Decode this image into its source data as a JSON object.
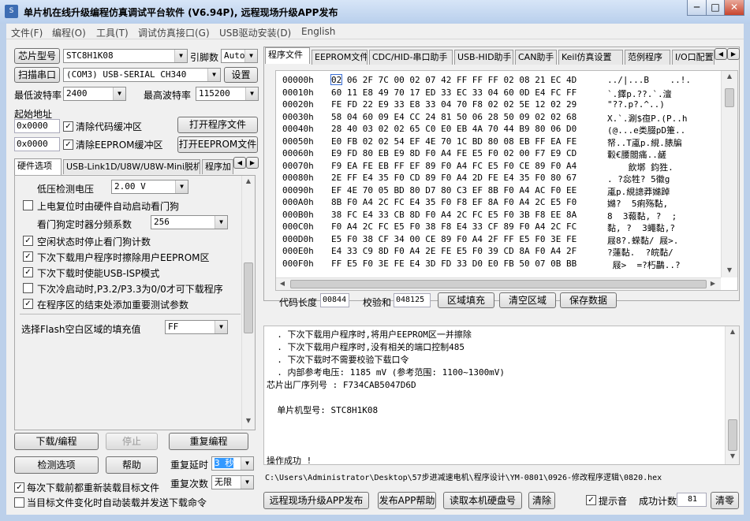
{
  "window": {
    "title": "单片机在线升级编程仿真调试平台软件 (V6.94P), 远程现场升级APP发布",
    "minimize": "─",
    "maximize": "□",
    "close": "✕"
  },
  "menu": [
    "文件(F)",
    "编程(O)",
    "工具(T)",
    "调试仿真接口(G)",
    "USB驱动安装(D)",
    "English"
  ],
  "left": {
    "chip_model_button": "芯片型号",
    "chip_model_value": "STC8H1K08",
    "pin_count_label": "引脚数",
    "pin_count_value": "Auto",
    "scan_port_button": "扫描串口",
    "port_value": "(COM3) USB-SERIAL CH340",
    "settings_button": "设置",
    "min_baud_label": "最低波特率",
    "min_baud_value": "2400",
    "max_baud_label": "最高波特率",
    "max_baud_value": "115200",
    "start_address_label": "起始地址",
    "code_addr_value": "0x0000",
    "clear_code_label": "清除代码缓冲区",
    "open_program_button": "打开程序文件",
    "eeprom_addr_value": "0x0000",
    "clear_eeprom_label": "清除EEPROM缓冲区",
    "open_eeprom_button": "打开EEPROM文件",
    "tabs": [
      "硬件选项",
      "USB-Link1D/U8W/U8W-Mini脱机",
      "程序加"
    ],
    "hw_options": {
      "lvd_label": "低压检测电压",
      "lvd_value": "2.00 V",
      "reset_wdt_label": "上电复位时由硬件自动启动看门狗",
      "wdt_prescale_label": "看门狗定时器分频系数",
      "wdt_prescale_value": "256",
      "idle_stop_wdt_label": "空闲状态时停止看门狗计数",
      "erase_eeprom_label": "下次下载用户程序时擦除用户EEPROM区",
      "usb_isp_label": "下次下载时使能USB-ISP模式",
      "p32_p33_label": "下次冷启动时,P3.2/P3.3为0/0才可下载程序",
      "add_params_label": "在程序区的结束处添加重要测试参数",
      "flash_fill_label": "选择Flash空白区域的填充值",
      "flash_fill_value": "FF"
    },
    "download_button": "下载/编程",
    "stop_button": "停止",
    "repeat_program_button": "重复编程",
    "check_options_button": "检测选项",
    "help_button": "帮助",
    "repeat_delay_label": "重复延时",
    "repeat_delay_value": "3 秒",
    "repeat_count_label": "重复次数",
    "repeat_count_value": "无限",
    "reload_label": "每次下载前都重新装载目标文件",
    "auto_load_label": "当目标文件变化时自动装载并发送下载命令"
  },
  "right": {
    "tabs": [
      "程序文件",
      "EEPROM文件",
      "CDC/HID-串口助手",
      "USB-HID助手",
      "CAN助手",
      "Keil仿真设置",
      "范例程序",
      "I/O口配置"
    ],
    "hex_rows": [
      {
        "addr": "00000h",
        "bytes": "02 06 2F 7C 00 02 07 42 FF FF FF 02 08 21 EC 4D",
        "ascii": "../|...B    ..!."
      },
      {
        "addr": "00010h",
        "bytes": "60 11 E8 49 70 17 ED 33 EC 33 04 60 0D E4 FC FF",
        "ascii": "`.鐸p.??.`.澶"
      },
      {
        "addr": "00020h",
        "bytes": "FE FD 22 E9 33 E8 33 04 70 F8 02 02 5E 12 02 29",
        "ascii": "\"??.p?.^..)"
      },
      {
        "addr": "00030h",
        "bytes": "58 04 60 09 E4 CC 24 81 50 06 28 50 09 02 02 68",
        "ascii": "X.`.涮$亱P.(P..h"
      },
      {
        "addr": "00040h",
        "bytes": "28 40 03 02 02 65 C0 E0 EB 4A 70 44 B9 80 06 D0",
        "ascii": "(@...e类腏pD箑.."
      },
      {
        "addr": "00050h",
        "bytes": "E0 FB 02 02 54 EF 4E 70 1C BD 80 08 EB FF EA FE",
        "ascii": "帑..T颪p.絸.脿牑"
      },
      {
        "addr": "00060h",
        "bytes": "E9 FD 80 EB E9 8D F0 A4 FE E5 F0 02 00 F7 E9 CD",
        "ascii": "轂€腰閸痛..鹾"
      },
      {
        "addr": "00070h",
        "bytes": "F9 EA FE EB FF EF 89 F0 A4 FC E5 F0 CE 89 F0 A4",
        "ascii": "    飲墎 鈞狌."
      },
      {
        "addr": "00080h",
        "bytes": "2E FF E4 35 F0 CD 89 F0 A4 2D FE E4 35 F0 80 67",
        "ascii": ". ?惢牲? 5徽g"
      },
      {
        "addr": "00090h",
        "bytes": "EF 4E 70 05 BD 80 D7 80 C3 EF 8B F0 A4 AC F0 EE",
        "ascii": "颪p.絸謥莽嬵踔"
      },
      {
        "addr": "000A0h",
        "bytes": "8B F0 A4 2C FC E4 35 F0 F8 EF 8A F0 A4 2C E5 F0",
        "ascii": "嬵?  5痢殇黏,"
      },
      {
        "addr": "000B0h",
        "bytes": "38 FC E4 33 CB 8D F0 A4 2C FC E5 F0 3B F8 EE 8A",
        "ascii": "8  3蕔黏, ?  ;"
      },
      {
        "addr": "000C0h",
        "bytes": "F0 A4 2C FC E5 F0 38 F8 E4 33 CF 89 F0 A4 2C FC",
        "ascii": "黏, ?  3蠅黏,?"
      },
      {
        "addr": "000D0h",
        "bytes": "E5 F0 38 CF 34 00 CE 89 F0 A4 2F FF E5 F0 3E FE",
        "ascii": "屐8?.蝾黏/ 屐>."
      },
      {
        "addr": "000E0h",
        "bytes": "E4 33 C9 8D F0 A4 2E FE E5 F0 39 CD 8A F0 A4 2F",
        "ascii": "?蓮黏.  ?皖黏/"
      },
      {
        "addr": "000F0h",
        "bytes": "FF E5 F0 3E FE E4 3D FD 33 D0 E0 FB 50 07 0B BB",
        "ascii": " 屐>  =?朽鸓..?"
      }
    ],
    "code_length_label": "代码长度",
    "code_length_value": "00844",
    "checksum_label": "校验和",
    "checksum_value": "048125",
    "fill_button": "区域填充",
    "clear_area_button": "清空区域",
    "save_data_button": "保存数据",
    "log_lines": [
      "  . 下次下载用户程序时,将用户EEPROM区一并擦除",
      "  . 下次下载用户程序时,没有相关的端口控制485",
      "  . 下次下载时不需要校验下载口令",
      "  . 内部参考电压: 1185 mV (参考范围: 1100~1300mV)",
      "芯片出厂序列号 : F734CAB5047D6D",
      "",
      "  单片机型号: STC8H1K08",
      "",
      "",
      "",
      "操作成功 !"
    ],
    "file_path": "C:\\Users\\Administrator\\Desktop\\57步进减速电机\\程序设计\\YM-0801\\0926-修改程序逻辑\\0820.hex",
    "remote_upgrade_button": "远程现场升级APP发布",
    "publish_help_button": "发布APP帮助",
    "read_disk_button": "读取本机硬盘号",
    "clear_button": "清除",
    "beep_label": "提示音",
    "success_count_label": "成功计数",
    "success_count_value": "81",
    "reset_count_button": "清零"
  }
}
